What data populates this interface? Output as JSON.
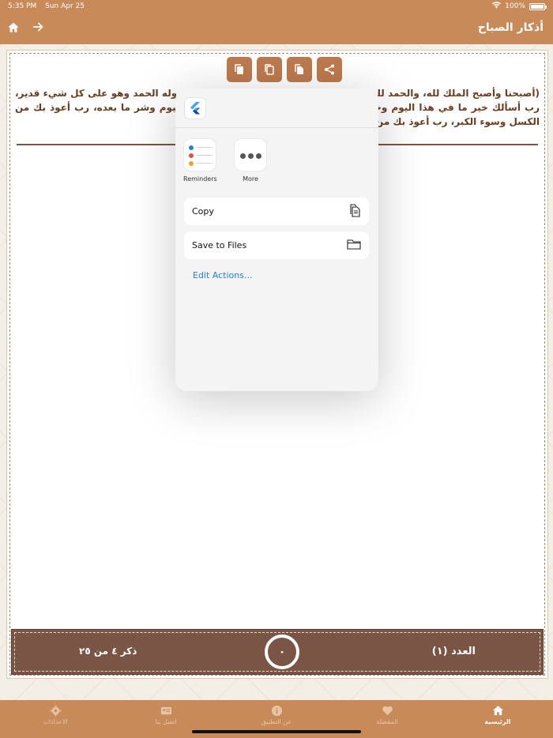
{
  "status": {
    "time": "5:35 PM",
    "date": "Sun Apr 25",
    "battery": "100%"
  },
  "nav": {
    "title": "أذكار الصباح"
  },
  "zikr": {
    "text": "(أصبحنا وأصبح الملك لله، والحمد لله، لا إله إلا الله وحده لا شريك له، له الملك وله الحمد وهو على كل شيء قدير، رب أسألك خير ما في هذا اليوم وخير ما بعده، وأعوذ بك من شر ما في هذا اليوم وشر ما بعده، رب أعوذ بك من الكسل وسوء الكبر، رب أعوذ بك من عذاب في النار وعذاب في القبر)"
  },
  "counter": {
    "count_label": "العدد (١)",
    "tap_value": "٠",
    "progress_label": "ذكر ٤ من ٢٥"
  },
  "share_sheet": {
    "apps": [
      {
        "label": "Reminders",
        "icon": "reminders-icon"
      },
      {
        "label": "More",
        "icon": "more-icon"
      }
    ],
    "actions": [
      {
        "label": "Copy",
        "icon": "copy-icon"
      },
      {
        "label": "Save to Files",
        "icon": "folder-icon"
      }
    ],
    "edit_actions": "Edit Actions..."
  },
  "tabs": [
    {
      "label": "الرئيسية",
      "icon": "home-icon",
      "active": true
    },
    {
      "label": "المفضلة",
      "icon": "heart-icon",
      "active": false
    },
    {
      "label": "عن التطبيق",
      "icon": "info-icon",
      "active": false
    },
    {
      "label": "اتصل بنا",
      "icon": "contact-card-icon",
      "active": false
    },
    {
      "label": "الاعدادات",
      "icon": "gear-icon",
      "active": false
    }
  ],
  "colors": {
    "accent": "#c98a5a",
    "counter_bg": "#7a5444",
    "text": "#6a3d22",
    "link": "#2a7ddc"
  }
}
